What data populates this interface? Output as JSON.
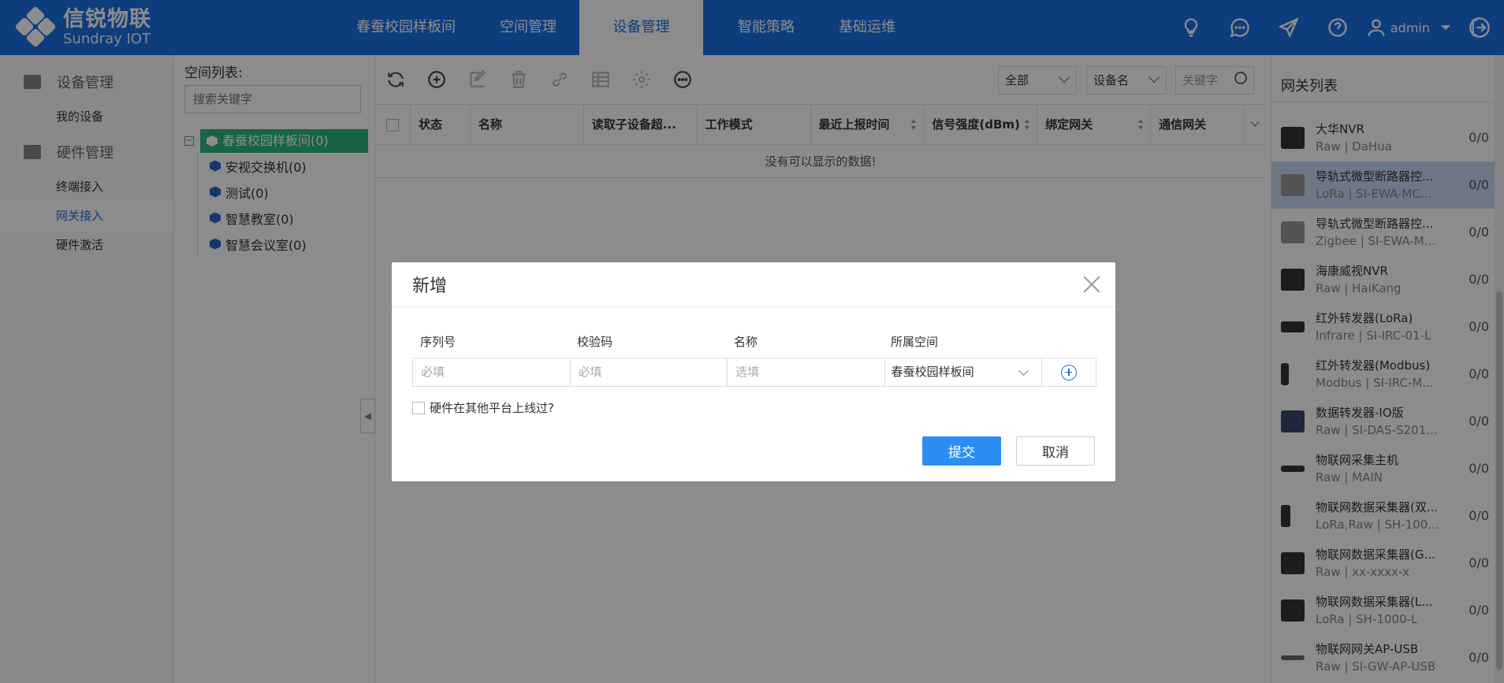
{
  "brand": {
    "name_cn": "信锐物联",
    "name_en": "Sundray IOT"
  },
  "nav": {
    "items": [
      "春蚕校园样板间",
      "空间管理",
      "设备管理",
      "智能策略",
      "基础运维"
    ],
    "active": "设备管理"
  },
  "user": {
    "name": "admin"
  },
  "left_nav": {
    "groups": [
      {
        "label": "设备管理",
        "items": [
          "我的设备"
        ]
      },
      {
        "label": "硬件管理",
        "items": [
          "终端接入",
          "网关接入",
          "硬件激活"
        ]
      }
    ],
    "active_item": "网关接入"
  },
  "space_panel": {
    "title": "空间列表:",
    "search_placeholder": "搜索关键字",
    "root": "春蚕校园样板间(0)",
    "children": [
      "安视交换机(0)",
      "测试(0)",
      "智慧教室(0)",
      "智慧会议室(0)"
    ]
  },
  "filters": {
    "scope": "全部",
    "field": "设备名",
    "keyword_placeholder": "关键字"
  },
  "grid": {
    "columns": [
      "状态",
      "名称",
      "读取子设备超...",
      "工作模式",
      "最近上报时间",
      "信号强度(dBm)",
      "绑定网关",
      "通信网关"
    ],
    "empty_text": "没有可以显示的数据!"
  },
  "gateway_panel": {
    "title": "网关列表",
    "items": [
      {
        "name": "大华NVR",
        "sub": "Raw | DaHua",
        "count": "0/0"
      },
      {
        "name": "导轨式微型断路器控...",
        "sub": "LoRa | SI-EWA-MC...",
        "count": "0/0"
      },
      {
        "name": "导轨式微型断路器控...",
        "sub": "Zigbee | SI-EWA-M...",
        "count": "0/0"
      },
      {
        "name": "海康威视NVR",
        "sub": "Raw | HaiKang",
        "count": "0/0"
      },
      {
        "name": "红外转发器(LoRa)",
        "sub": "Infrare | SI-IRC-01-L",
        "count": "0/0"
      },
      {
        "name": "红外转发器(Modbus)",
        "sub": "Modbus | SI-IRC-M...",
        "count": "0/0"
      },
      {
        "name": "数据转发器-IO版",
        "sub": "Raw | SI-DAS-S201...",
        "count": "0/0"
      },
      {
        "name": "物联网采集主机",
        "sub": "Raw | MAIN",
        "count": "0/0"
      },
      {
        "name": "物联网数据采集器(双...",
        "sub": "LoRa,Raw | SH-100...",
        "count": "0/0"
      },
      {
        "name": "物联网数据采集器(G...",
        "sub": "Raw | xx-xxxx-x",
        "count": "0/0"
      },
      {
        "name": "物联网数据采集器(L...",
        "sub": "LoRa | SH-1000-L",
        "count": "0/0"
      },
      {
        "name": "物联网网关AP-USB",
        "sub": "Raw | SI-GW-AP-USB",
        "count": "0/0"
      }
    ],
    "selected_index": 1
  },
  "dialog": {
    "title": "新增",
    "headers": [
      "序列号",
      "校验码",
      "名称",
      "所属空间"
    ],
    "serial_placeholder": "必填",
    "code_placeholder": "必填",
    "name_placeholder": "选填",
    "space_value": "春蚕校园样板间",
    "checkbox_label": "硬件在其他平台上线过?",
    "submit": "提交",
    "cancel": "取消"
  }
}
